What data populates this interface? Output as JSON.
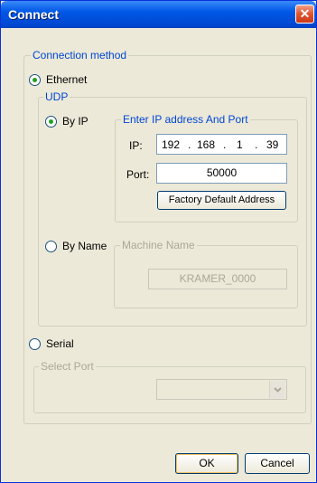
{
  "window": {
    "title": "Connect",
    "close_symbol": "✕"
  },
  "connection_method": {
    "legend": "Connection method",
    "ethernet_label": "Ethernet",
    "ethernet_selected": true,
    "serial_label": "Serial",
    "serial_selected": false
  },
  "udp": {
    "legend": "UDP",
    "by_ip_label": "By IP",
    "by_ip_selected": true,
    "by_name_label": "By Name",
    "by_name_selected": false
  },
  "ip_group": {
    "legend": "Enter IP address And Port",
    "ip_label": "IP:",
    "ip_octets": [
      "192",
      "168",
      "1",
      "39"
    ],
    "ip_dot": ".",
    "port_label": "Port:",
    "port_value": "50000",
    "factory_button": "Factory Default Address"
  },
  "name_group": {
    "legend": "Machine Name",
    "machine_name": "KRAMER_0000"
  },
  "serial_group": {
    "legend": "Select Port",
    "selected_port": "",
    "dropdown_icon": "chevron-down-icon"
  },
  "buttons": {
    "ok": "OK",
    "cancel": "Cancel"
  }
}
